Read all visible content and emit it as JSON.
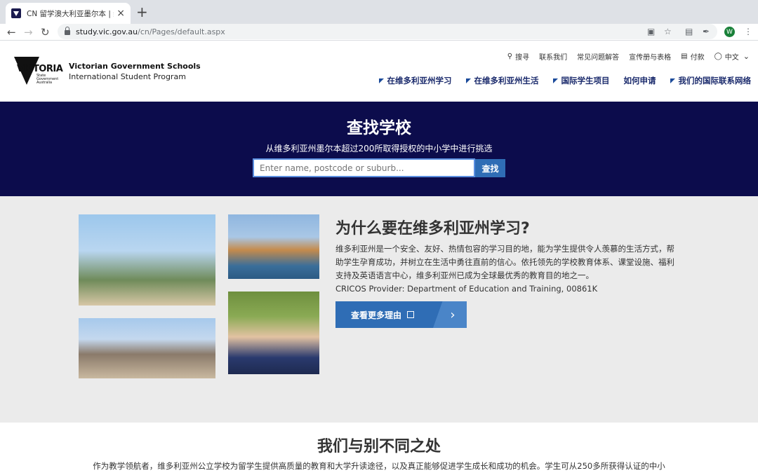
{
  "browser": {
    "tab_title": "CN 留学澳大利亚墨尔本 | 维多利亚",
    "tab_close": "×",
    "new_tab": "+",
    "url_host": "study.vic.gov.au",
    "url_path": "/cn/Pages/default.aspx",
    "avatar_letter": "W"
  },
  "header": {
    "logo_word": "VICTORIA",
    "logo_sub": "State Government Australia",
    "org_line1": "Victorian Government Schools",
    "org_line2": "International Student Program",
    "utility_nav": [
      {
        "label": "搜寻",
        "icon": "search-icon"
      },
      {
        "label": "联系我们"
      },
      {
        "label": "常见问题解答"
      },
      {
        "label": "宣传册与表格"
      },
      {
        "label": "付款",
        "icon": "card-icon"
      },
      {
        "label": "中文",
        "icon": "globe-icon"
      }
    ],
    "main_nav": [
      {
        "label": "在维多利亚州学习"
      },
      {
        "label": "在维多利亚州生活"
      },
      {
        "label": "国际学生项目"
      },
      {
        "label": "如何申请"
      },
      {
        "label": "我们的国际联系网络"
      }
    ]
  },
  "hero": {
    "title": "查找学校",
    "subtitle": "从维多利亚州墨尔本超过200所取得授权的中小学中进行挑选",
    "search_placeholder": "Enter name, postcode or suburb...",
    "search_button": "查找"
  },
  "why": {
    "title": "为什么要在维多利亚州学习?",
    "body": "维多利亚州是一个安全、友好、热情包容的学习目的地，能为学生提供令人羡慕的生活方式，帮助学生孕育成功，并树立在生活中勇往直前的信心。依托领先的学校教育体系、课堂设施、福利支持及英语语言中心，维多利亚州已成为全球最优秀的教育目的地之一。",
    "cricos": "CRICOS Provider: Department of Education and Training, 00861K",
    "more_button": "查看更多理由"
  },
  "diff": {
    "title": "我们与别不同之处",
    "body": "作为教学领航者，维多利亚州公立学校为留学生提供高质量的教育和大学升读途径，以及真正能够促进学生成长和成功的机会。学生可从250多所获得认证的中小"
  },
  "colors": {
    "hero_bg": "#0c0c4c",
    "accent_blue": "#2f6db5",
    "nav_text": "#1a2a6c",
    "section_gray": "#ebebeb"
  }
}
